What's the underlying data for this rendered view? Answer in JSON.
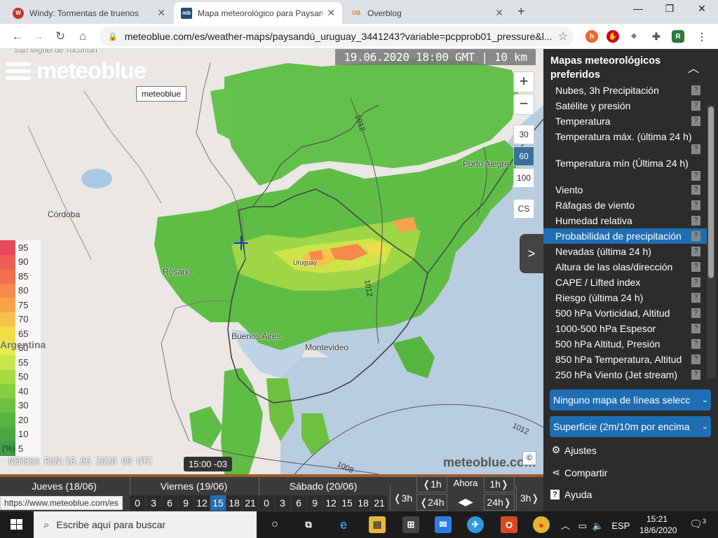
{
  "browser": {
    "tabs": [
      {
        "title": "Windy: Tormentas de truenos",
        "favicon": "windy-icon",
        "color": "#c0392b",
        "fav_text": "W"
      },
      {
        "title": "Mapa meteorológico para Paysan",
        "favicon": "meteoblue-icon",
        "color": "#1f4e79",
        "fav_text": "mb"
      },
      {
        "title": "Overblog",
        "favicon": "overblog-icon",
        "color": "#f0f0f0",
        "fav_text": "OB"
      }
    ],
    "address_url": "meteoblue.com/es/weather-maps/paysandú_uruguay_3441243?variable=pcpprob01_pressure&l...",
    "window_controls": [
      "minimize-icon",
      "maximize-icon",
      "close-icon"
    ]
  },
  "map": {
    "logo_text": "meteoblue",
    "tooltip": "meteoblue",
    "datetime": "19.06.2020 18:00 GMT | 10 km",
    "zoom_in": "+",
    "zoom_out": "−",
    "scales": [
      "30",
      "60",
      "100"
    ],
    "scale_selected": "60",
    "cs_label": "CS",
    "legend": {
      "levels": [
        "95",
        "90",
        "85",
        "80",
        "75",
        "70",
        "65",
        "60",
        "55",
        "50",
        "40",
        "30",
        "20",
        "10",
        "5"
      ],
      "colors": [
        "#e8485a",
        "#ef5d55",
        "#f1704c",
        "#f58a4b",
        "#f7a34a",
        "#f6c24a",
        "#f3dc49",
        "#e6ec4a",
        "#cae548",
        "#a8da44",
        "#86cf40",
        "#6cc140",
        "#58b441",
        "#48a845",
        "#3f9d4b"
      ],
      "unit": "(%)"
    },
    "cities": {
      "cordoba": "Córdoba",
      "rosario": "Rosario",
      "buenos_aires": "Buenos Aires",
      "montevideo": "Montevideo",
      "uruguay": "Uruguay",
      "porto_alegre": "Porto Alegre",
      "argentina": "Argentina",
      "top_town": "San Miguel de Tucumán"
    },
    "isobars": [
      "1012",
      "1012",
      "1012",
      "1008"
    ],
    "run_info": "NEMSSA RUN:18.06 2020 00 UTC",
    "local_time": "15:00 -03",
    "watermark": "meteoblue.com",
    "copyright": "©",
    "nav_arrow": ">"
  },
  "panel": {
    "title": "Mapas meteorológicos preferidos",
    "items": [
      "Nubes, 3h Precipitación",
      "Satélite y presión",
      "Temperatura",
      "Temperatura máx. (última 24 h)",
      "Temperatura mín (Última 24 h)",
      "Viento",
      "Ráfagas de viento",
      "Humedad relativa",
      "Probabilidad de precipitación",
      "Nevadas (última 24 h)",
      "Altura de las olas/dirección",
      "CAPE / Lifted index",
      "Riesgo (última 24 h)",
      "500 hPa Vorticidad, Altitud",
      "1000-500 hPa Espesor",
      "500 hPa Altitud, Presión",
      "850 hPa Temperatura, Altitud",
      "250 hPa Viento (Jet stream)"
    ],
    "selected_item": "Probabilidad de precipitación",
    "help_glyph": "?",
    "lines_select": "Ninguno mapa de líneas selecc",
    "level_select": "Superficie (2m/10m por encima",
    "settings": "Ajustes",
    "share": "Compartir",
    "help": "Ayuda"
  },
  "timeline": {
    "days": [
      "Jueves (18/06)",
      "Viernes (19/06)",
      "Sábado (20/06)"
    ],
    "hours_fri": [
      "0",
      "3",
      "6",
      "9",
      "12",
      "15",
      "18",
      "21"
    ],
    "hours_sat": [
      "0",
      "3",
      "6",
      "9",
      "12",
      "15",
      "18",
      "21"
    ],
    "selected_hour": "15",
    "back_3h": "❬3h",
    "back_1h": "❬1h",
    "back_24h": "❬24h",
    "now": "Ahora",
    "fwd_1h": "1h❭",
    "fwd_24h": "24h❭",
    "fwd_3h": "3h❭",
    "arrows": "◀▶"
  },
  "status_url": "https://www.meteoblue.com/es",
  "taskbar": {
    "search_placeholder": "Escribe aquí para buscar",
    "language": "ESP",
    "time": "15:21",
    "date": "18/6/2020",
    "notifications": "3"
  }
}
